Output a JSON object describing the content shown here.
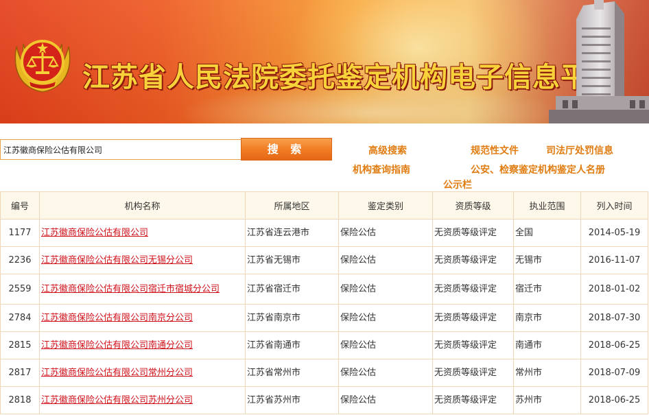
{
  "header": {
    "title": "江苏省人民法院委托鉴定机构电子信息平台"
  },
  "search": {
    "value": "江苏徽商保险公估有限公司",
    "button_label": "搜 索"
  },
  "nav": {
    "advanced_search": "高级搜索",
    "normative_docs": "规范性文件",
    "penalty_info": "司法厅处罚信息",
    "query_guide": "机构查询指南",
    "police_list": "公安、检察鉴定机构鉴定人名册",
    "bulletin": "公示栏"
  },
  "table": {
    "columns": [
      "编号",
      "机构名称",
      "所属地区",
      "鉴定类别",
      "资质等级",
      "执业范围",
      "列入时间"
    ],
    "rows": [
      {
        "id": "1177",
        "name": "江苏徽商保险公估有限公司",
        "region": "江苏省连云港市",
        "category": "保险公估",
        "level": "无资质等级评定",
        "scope": "全国",
        "date": "2014-05-19"
      },
      {
        "id": "2236",
        "name": "江苏徽商保险公估有限公司无锡分公司",
        "region": "江苏省无锡市",
        "category": "保险公估",
        "level": "无资质等级评定",
        "scope": "无锡市",
        "date": "2016-11-07"
      },
      {
        "id": "2559",
        "name": "江苏徽商保险公估有限公司宿迁市宿城分公司",
        "region": "江苏省宿迁市",
        "category": "保险公估",
        "level": "无资质等级评定",
        "scope": "宿迁市",
        "date": "2018-01-02"
      },
      {
        "id": "2784",
        "name": "江苏徽商保险公估有限公司南京分公司",
        "region": "江苏省南京市",
        "category": "保险公估",
        "level": "无资质等级评定",
        "scope": "南京市",
        "date": "2018-07-30"
      },
      {
        "id": "2815",
        "name": "江苏徽商保险公估有限公司南通分公司",
        "region": "江苏省南通市",
        "category": "保险公估",
        "level": "无资质等级评定",
        "scope": "南通市",
        "date": "2018-06-25"
      },
      {
        "id": "2817",
        "name": "江苏徽商保险公估有限公司常州分公司",
        "region": "江苏省常州市",
        "category": "保险公估",
        "level": "无资质等级评定",
        "scope": "常州市",
        "date": "2018-07-09"
      },
      {
        "id": "2818",
        "name": "江苏徽商保险公估有限公司苏州分公司",
        "region": "江苏省苏州市",
        "category": "保险公估",
        "level": "无资质等级评定",
        "scope": "苏州市",
        "date": "2018-06-25"
      }
    ]
  },
  "icons": {
    "emblem": "court-emblem-icon",
    "building": "courthouse-building-icon"
  },
  "colors": {
    "title_text": "#f7d23a",
    "title_outline": "#8b1a0c",
    "link_orange": "#e07d12",
    "name_link_red": "#d0121b",
    "search_button": "#f07a22",
    "table_border": "#f0d6b8",
    "header_bg": "#fdf8e9"
  }
}
